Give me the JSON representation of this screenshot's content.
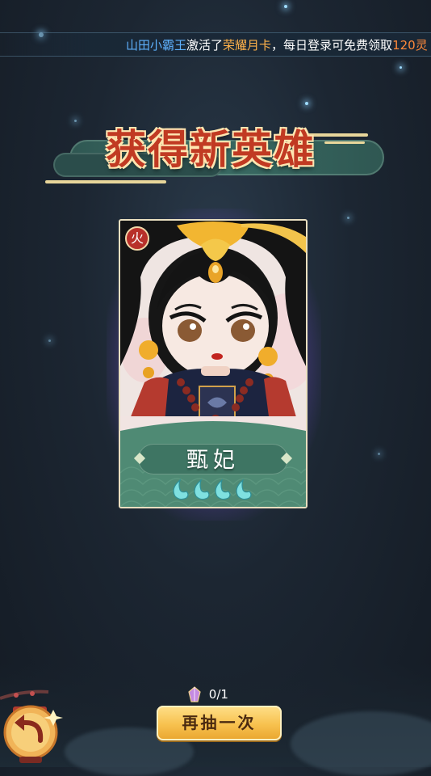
{
  "marquee": {
    "player_name": "山田小霸王",
    "action_text": "激活了",
    "item_name": "荣耀月卡",
    "tail_text": "，每日登录可免费领取",
    "amount_text": "120灵"
  },
  "title_banner": {
    "text": "获得新英雄"
  },
  "hero_card": {
    "element_badge": "火",
    "hero_name": "甄妃",
    "star_count": 4,
    "colors": {
      "glow": "#7a4fd8",
      "footer": "#4f8a74",
      "badge": "#b8302a"
    }
  },
  "draw_counter": {
    "text": "0/1",
    "icon": "crystal-icon"
  },
  "redraw_button": {
    "label": "再抽一次"
  },
  "back_button": {
    "icon": "back-arrow-icon"
  },
  "colors": {
    "background": "#1c2632",
    "button_gold": "#f7c14e",
    "marquee_name": "#5fb2ff",
    "marquee_item": "#ffb24a"
  }
}
